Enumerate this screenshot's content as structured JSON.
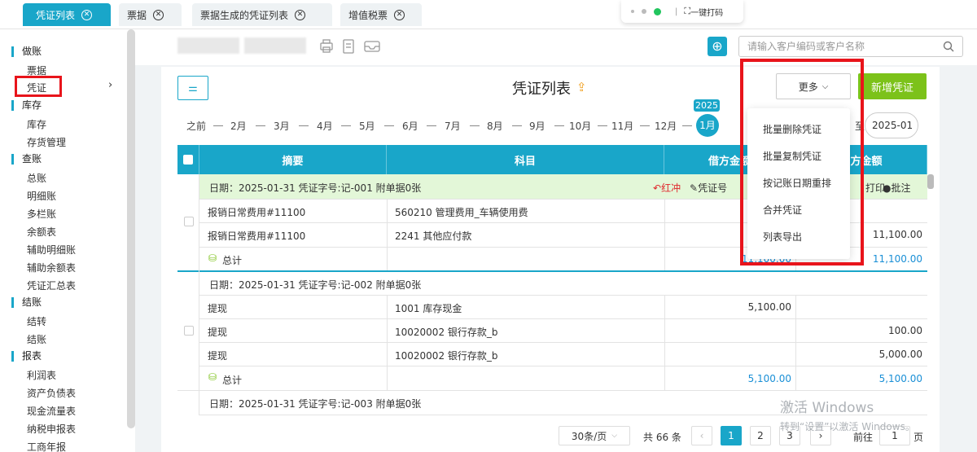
{
  "tabs": [
    {
      "label": "凭证列表",
      "active": true
    },
    {
      "label": "票据",
      "active": false
    },
    {
      "label": "票据生成的凭证列表",
      "active": false
    },
    {
      "label": "增值税票",
      "active": false
    }
  ],
  "float_toolbar": {
    "print_label": "一键打码"
  },
  "sidebar": {
    "sections": [
      {
        "title": "做账",
        "items": [
          "票据",
          "凭证"
        ]
      },
      {
        "title": "库存",
        "items": [
          "库存",
          "存货管理"
        ]
      },
      {
        "title": "查账",
        "items": [
          "总账",
          "明细账",
          "多栏账",
          "余额表",
          "辅助明细账",
          "辅助余额表",
          "凭证汇总表"
        ]
      },
      {
        "title": "结账",
        "items": [
          "结转",
          "结账"
        ]
      },
      {
        "title": "报表",
        "items": [
          "利润表",
          "资产负债表",
          "现金流量表",
          "纳税申报表",
          "工商年报"
        ]
      }
    ]
  },
  "search": {
    "placeholder": "请输入客户编码或客户名称"
  },
  "page_title": "凭证列表",
  "buttons": {
    "more": "更多",
    "new_voucher": "新增凭证"
  },
  "timeline": {
    "before": "之前",
    "year": "2025",
    "months": [
      "2月",
      "3月",
      "4月",
      "5月",
      "6月",
      "7月",
      "8月",
      "9月",
      "10月",
      "11月",
      "12月"
    ],
    "selected": "1月",
    "to_label": "至",
    "period_end": "2025-01"
  },
  "table": {
    "headers": [
      "摘要",
      "科目",
      "借方金额",
      "贷方金额"
    ],
    "vouchers": [
      {
        "header": "日期：2025-01-31  凭证字号:记-001  附单据0张",
        "actions": [
          "红冲",
          "凭证号",
          "打印",
          "批注"
        ],
        "rows": [
          {
            "summary": "报销日常费用#11100",
            "account": "560210 管理费用_车辆使用费",
            "debit": "",
            "credit": ""
          },
          {
            "summary": "报销日常费用#11100",
            "account": "2241 其他应付款",
            "debit": "",
            "credit": "11,100.00"
          }
        ],
        "total_label": "总计",
        "total_debit": "11,100.00",
        "total_credit": "11,100.00"
      },
      {
        "header": "日期：2025-01-31  凭证字号:记-002  附单据0张",
        "rows": [
          {
            "summary": "提现",
            "account": "1001 库存现金",
            "debit": "5,100.00",
            "credit": ""
          },
          {
            "summary": "提现",
            "account": "10020002 银行存款_b",
            "debit": "",
            "credit": "100.00"
          },
          {
            "summary": "提现",
            "account": "10020002 银行存款_b",
            "debit": "",
            "credit": "5,000.00"
          }
        ],
        "total_label": "总计",
        "total_debit": "5,100.00",
        "total_credit": "5,100.00"
      },
      {
        "header": "日期：2025-01-31  凭证字号:记-003  附单据0张"
      }
    ]
  },
  "more_menu": [
    "批量删除凭证",
    "批量复制凭证",
    "按记账日期重排",
    "合并凭证",
    "列表导出"
  ],
  "pagination": {
    "page_size": "30条/页",
    "total": "共 66 条",
    "pages": [
      "1",
      "2",
      "3"
    ],
    "current": "1",
    "goto_label": "前往",
    "goto_value": "1",
    "page_suffix": "页"
  },
  "watermark": {
    "line1": "激活 Windows",
    "line2": "转到“设置”以激活 Windows。"
  },
  "colors": {
    "accent": "#19a6c9",
    "green": "#7cc21a",
    "highlight_row": "#e3f7d8",
    "red_box": "#e8141b",
    "link_blue": "#1a8fd6"
  }
}
